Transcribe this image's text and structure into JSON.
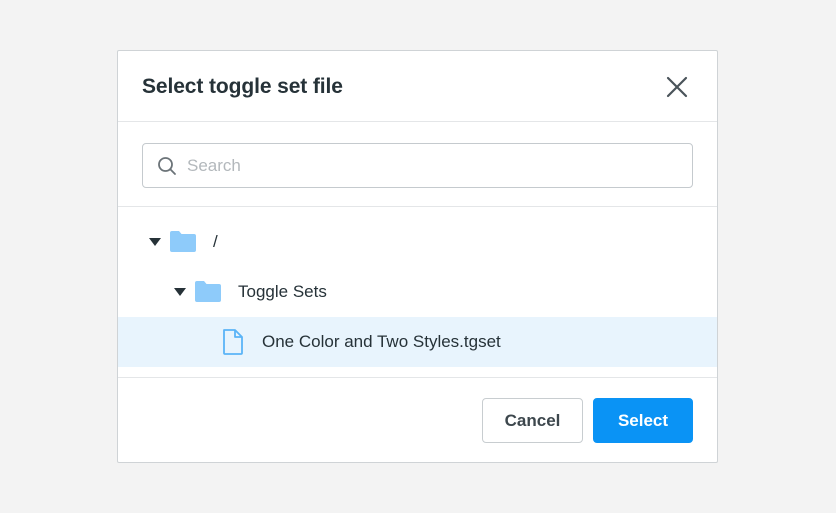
{
  "dialog": {
    "title": "Select toggle set file",
    "close_icon": "close-icon"
  },
  "search": {
    "placeholder": "Search",
    "value": "",
    "icon": "search-icon"
  },
  "tree": {
    "items": [
      {
        "label": "/",
        "type": "folder",
        "expanded": true,
        "selected": false,
        "depth": 0
      },
      {
        "label": "Toggle Sets",
        "type": "folder",
        "expanded": true,
        "selected": false,
        "depth": 1
      },
      {
        "label": "One Color and Two Styles.tgset",
        "type": "file",
        "selected": true,
        "depth": 2
      }
    ]
  },
  "footer": {
    "cancel_label": "Cancel",
    "select_label": "Select"
  },
  "colors": {
    "accent": "#0a93f5",
    "folder": "#8ecbfa",
    "selected_row": "#e8f4fd",
    "background": "#f3f3f3"
  }
}
